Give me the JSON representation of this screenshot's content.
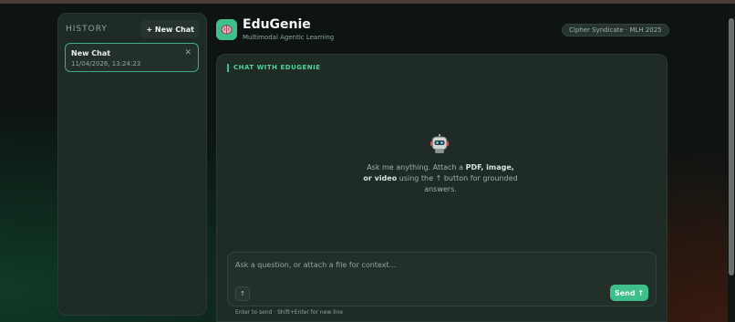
{
  "history": {
    "title": "HISTORY",
    "new_chat_label": "+ New Chat",
    "items": [
      {
        "title": "New Chat",
        "date": "11/04/2026, 13:24:23",
        "close": "✕"
      }
    ]
  },
  "header": {
    "title": "EduGenie",
    "subtitle": "Multimodal Agentic Learning",
    "badge": "Cipher Syndicate · MLH 2025",
    "logo_icon": "brain-icon"
  },
  "chat": {
    "section_title": "CHAT WITH EDUGENIE",
    "empty_icon": "robot-icon",
    "empty_text": {
      "part1": "Ask me anything. Attach a ",
      "bold1": "PDF, image, or video",
      "part2": " using the ",
      "attach_glyph": "↑",
      "part3": " button for grounded answers."
    },
    "input_placeholder": "Ask a question, or attach a file for context...",
    "attach_label": "↑",
    "send_label": "Send ↑",
    "hint": "Enter to send · Shift+Enter for new line"
  },
  "colors": {
    "accent": "#3fbf8c",
    "panel": "#1f2b25",
    "background": "#0d1411"
  }
}
